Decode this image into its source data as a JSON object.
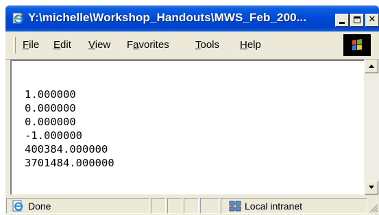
{
  "window": {
    "title": "Y:\\michelle\\Workshop_Handouts\\MWS_Feb_200..."
  },
  "menu": {
    "items": [
      {
        "label": "ile",
        "accel": "F"
      },
      {
        "label": "dit",
        "accel": "E"
      },
      {
        "label": "iew",
        "accel": "V"
      },
      {
        "label": "a",
        "accel": "F",
        "rest": "vorites"
      },
      {
        "label": "ools",
        "accel": "T"
      },
      {
        "label": "elp",
        "accel": "H"
      }
    ]
  },
  "content": {
    "lines": [
      "1.000000",
      "0.000000",
      "0.000000",
      "-1.000000",
      "400384.000000",
      "3701484.000000"
    ]
  },
  "status": {
    "text": "Done",
    "zone": "Local intranet"
  },
  "icons": {
    "app": "ie-page-icon",
    "windows_logo": "windows-flag-icon",
    "status": "ie-page-icon",
    "zone": "local-intranet-icon"
  },
  "colors": {
    "titlebar": "#0048d8",
    "chrome": "#ece9d8"
  }
}
